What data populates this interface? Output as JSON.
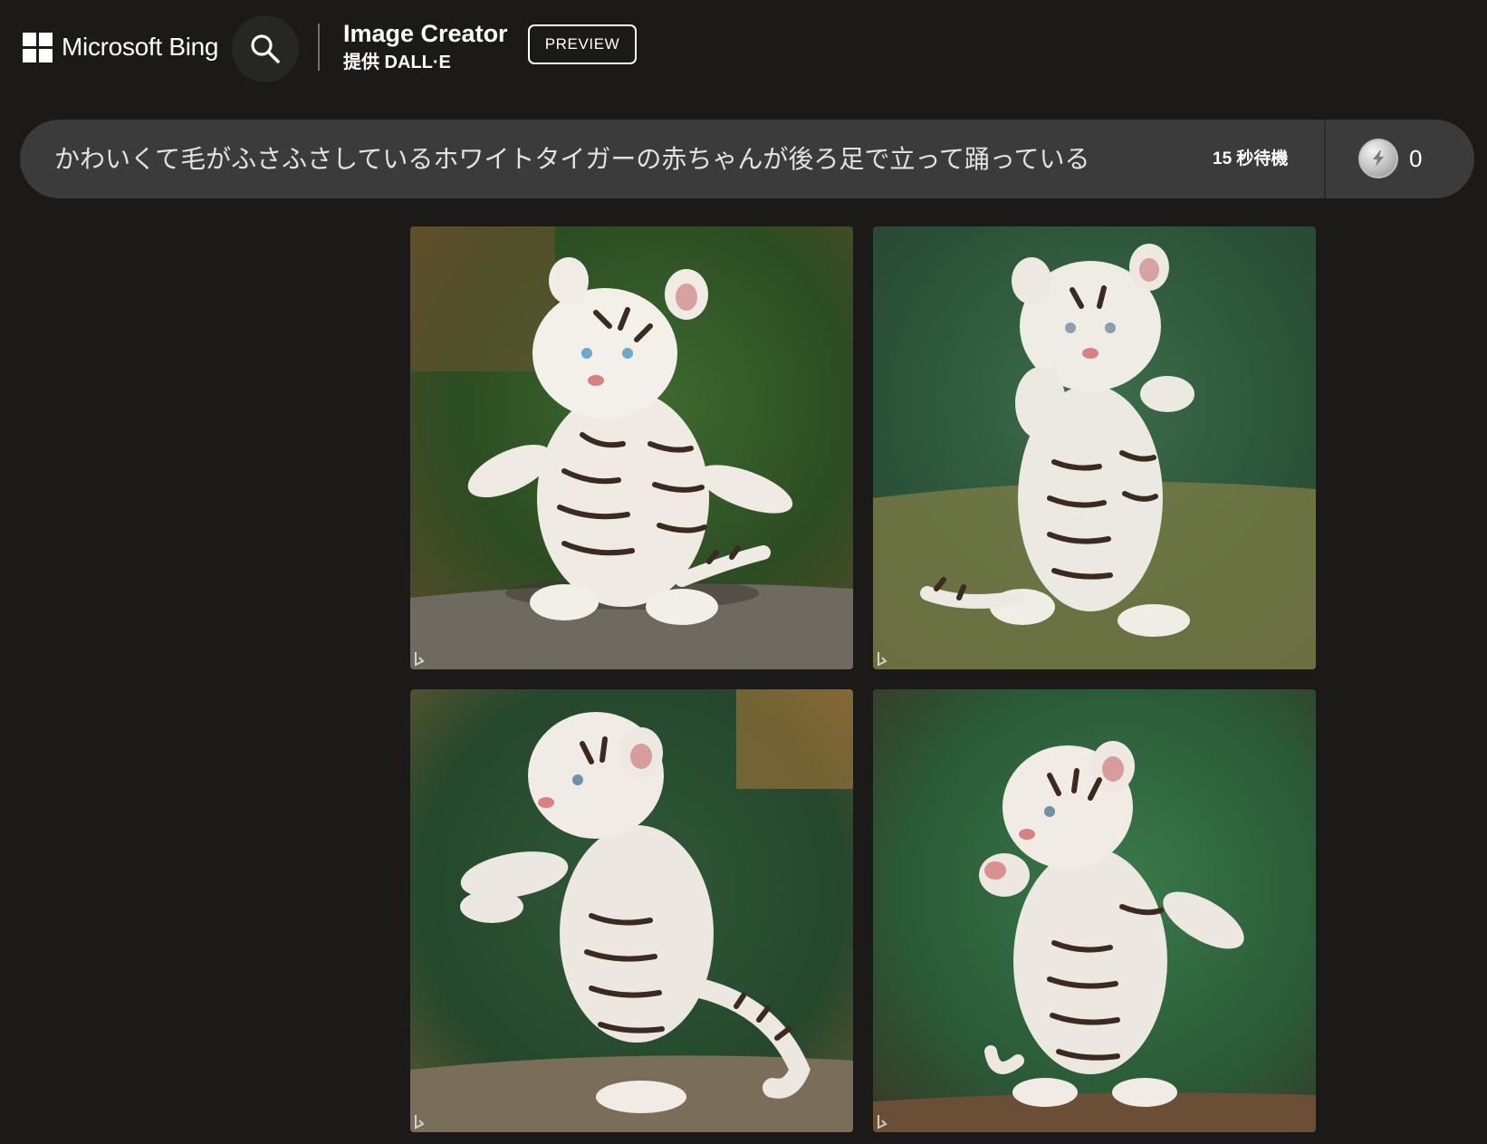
{
  "header": {
    "brand_name": "Microsoft Bing",
    "product_title": "Image Creator",
    "product_subtitle": "提供 DALL·E",
    "preview_label": "PREVIEW"
  },
  "prompt_bar": {
    "prompt": "かわいくて毛がふさふさしているホワイトタイガーの赤ちゃんが後ろ足で立って踊っている",
    "wait_text": "15 秒待機",
    "boost_count": "0"
  },
  "images": [
    {
      "subject": "white-tiger-cub-dancing-1"
    },
    {
      "subject": "white-tiger-cub-dancing-2"
    },
    {
      "subject": "white-tiger-cub-dancing-3"
    },
    {
      "subject": "white-tiger-cub-dancing-4"
    }
  ],
  "colors": {
    "page_bg": "#1b1a19",
    "prompt_bar_bg": "#3b3b3b",
    "search_button_bg": "#262625"
  }
}
